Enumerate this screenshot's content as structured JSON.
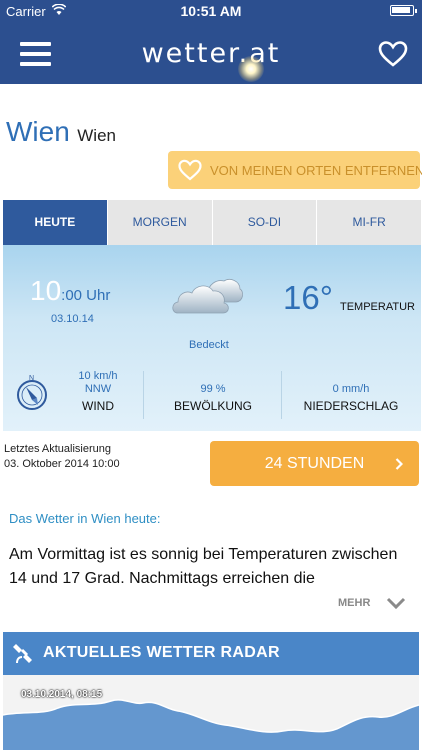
{
  "status_bar": {
    "carrier": "Carrier",
    "time": "10:51 AM"
  },
  "nav": {
    "logo": "wetter.at"
  },
  "city": {
    "name": "Wien",
    "region": "Wien"
  },
  "remove_button": {
    "label": "VON MEINEN ORTEN ENTFERNEN"
  },
  "tabs": [
    {
      "label": "HEUTE",
      "active": true
    },
    {
      "label": "MORGEN",
      "active": false
    },
    {
      "label": "SO-DI",
      "active": false
    },
    {
      "label": "MI-FR",
      "active": false
    }
  ],
  "current": {
    "hour": "10",
    "hour_suffix": ":00 Uhr",
    "date": "03.10.14",
    "condition": "Bedeckt",
    "temperature": "16°",
    "temperature_label": "TEMPERATUR",
    "wind": {
      "speed": "10 km/h",
      "direction": "NNW",
      "label": "WIND"
    },
    "cloud": {
      "value": "99 %",
      "label": "BEWÖLKUNG"
    },
    "rain": {
      "value": "0 mm/h",
      "label": "NIEDERSCHLAG"
    }
  },
  "update": {
    "label": "Letztes Aktualisierung",
    "date": "03. Oktober 2014 10:00"
  },
  "hours_button": {
    "label": "24 STUNDEN"
  },
  "forecast": {
    "heading": "Das Wetter in Wien heute:",
    "text": "Am Vormittag ist es sonnig bei Temperaturen zwischen 14 und 17 Grad. Nachmittags erreichen die",
    "more_label": "MEHR"
  },
  "radar": {
    "label": "AKTUELLES WETTER RADAR",
    "timestamp": "03.10.2014, 08:15"
  },
  "colors": {
    "brand": "#2c4f8f",
    "accent": "#f5ae40",
    "link": "#2f6fb6",
    "radar": "#4a86c8"
  }
}
